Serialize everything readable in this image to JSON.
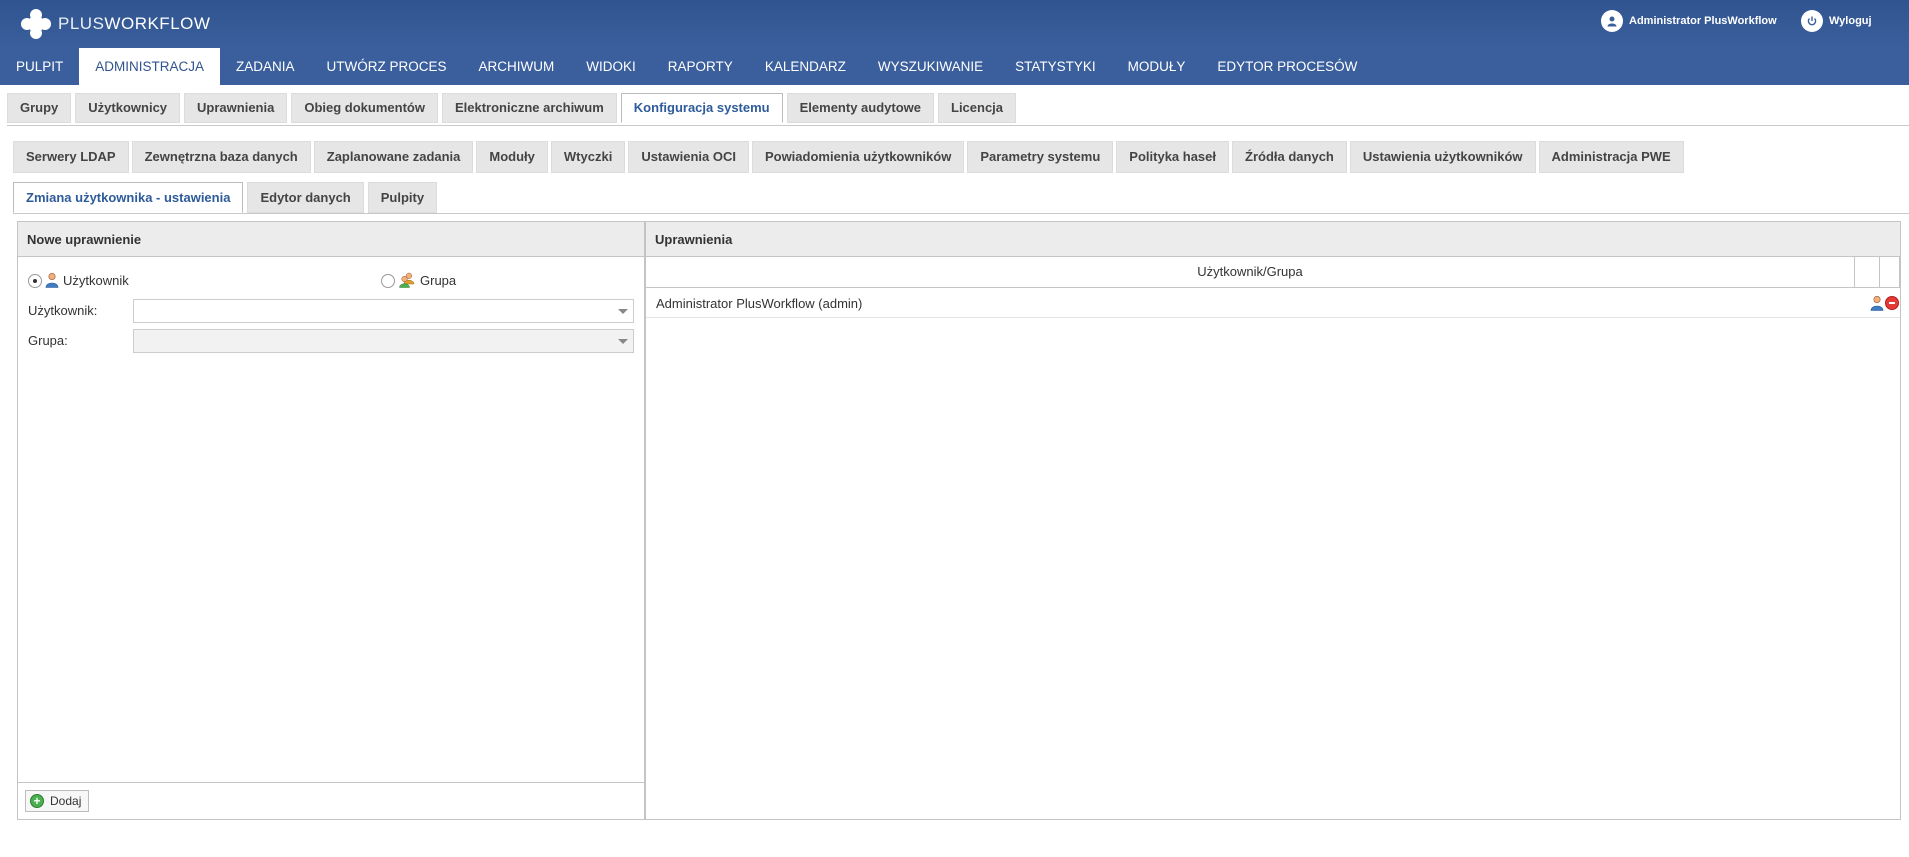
{
  "header": {
    "logo_text_left": "PLUS",
    "logo_text_right": "WORKFLOW",
    "user_label": "Administrator PlusWorkflow",
    "logout_label": "Wyloguj"
  },
  "main_nav": [
    {
      "label": "PULPIT"
    },
    {
      "label": "ADMINISTRACJA",
      "active": true
    },
    {
      "label": "ZADANIA"
    },
    {
      "label": "UTWÓRZ PROCES"
    },
    {
      "label": "ARCHIWUM"
    },
    {
      "label": "WIDOKI"
    },
    {
      "label": "RAPORTY"
    },
    {
      "label": "KALENDARZ"
    },
    {
      "label": "WYSZUKIWANIE"
    },
    {
      "label": "STATYSTYKI"
    },
    {
      "label": "MODUŁY"
    },
    {
      "label": "EDYTOR PROCESÓW"
    }
  ],
  "tabs_level1": [
    {
      "label": "Grupy"
    },
    {
      "label": "Użytkownicy"
    },
    {
      "label": "Uprawnienia"
    },
    {
      "label": "Obieg dokumentów"
    },
    {
      "label": "Elektroniczne archiwum"
    },
    {
      "label": "Konfiguracja systemu",
      "active": true
    },
    {
      "label": "Elementy audytowe"
    },
    {
      "label": "Licencja"
    }
  ],
  "tabs_level2": [
    {
      "label": "Serwery LDAP"
    },
    {
      "label": "Zewnętrzna baza danych"
    },
    {
      "label": "Zaplanowane zadania"
    },
    {
      "label": "Moduły"
    },
    {
      "label": "Wtyczki"
    },
    {
      "label": "Ustawienia OCI"
    },
    {
      "label": "Powiadomienia użytkowników"
    },
    {
      "label": "Parametry systemu"
    },
    {
      "label": "Polityka haseł"
    },
    {
      "label": "Źródła danych"
    },
    {
      "label": "Ustawienia użytkowników"
    },
    {
      "label": "Administracja PWE"
    }
  ],
  "tabs_level3": [
    {
      "label": "Zmiana użytkownika - ustawienia",
      "active": true
    },
    {
      "label": "Edytor danych"
    },
    {
      "label": "Pulpity"
    }
  ],
  "left_panel": {
    "title": "Nowe uprawnienie",
    "radio_user_label": "Użytkownik",
    "radio_group_label": "Grupa",
    "user_field_label": "Użytkownik:",
    "user_field_value": "",
    "group_field_label": "Grupa:",
    "group_field_value": "",
    "add_button_label": "Dodaj"
  },
  "right_panel": {
    "title": "Uprawnienia",
    "column_header": "Użytkownik/Grupa",
    "rows": [
      {
        "name": "Administrator PlusWorkflow (admin)"
      }
    ]
  },
  "colors": {
    "header_blue": "#3a5f9c",
    "active_tab_text": "#2e5b9a"
  }
}
